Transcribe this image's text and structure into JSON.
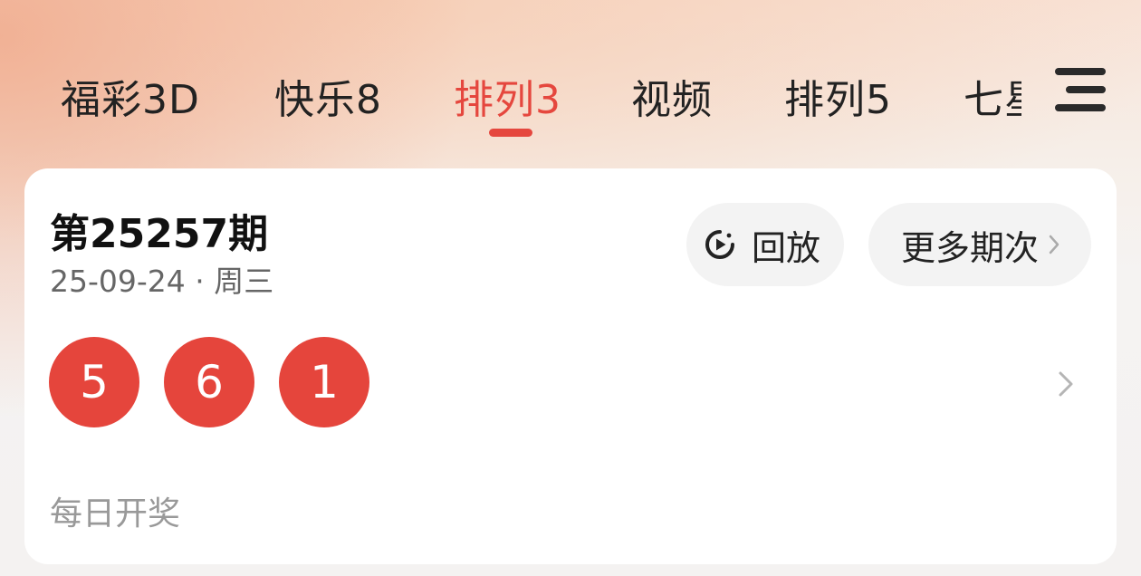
{
  "tabs": [
    {
      "label": "福彩3D"
    },
    {
      "label": "快乐8"
    },
    {
      "label": "排列3",
      "active": true
    },
    {
      "label": "视频"
    },
    {
      "label": "排列5"
    },
    {
      "label": "七星彩"
    }
  ],
  "menu_icon": "hamburger-menu-icon",
  "draw": {
    "issue": "第25257期",
    "date": "25-09-24 · 周三",
    "numbers": [
      "5",
      "6",
      "1"
    ],
    "schedule": "每日开奖"
  },
  "actions": {
    "replay_label": "回放",
    "replay_icon": "play-replay-icon",
    "more_label": "更多期次"
  },
  "colors": {
    "accent": "#e5473e",
    "ball": "#e5453c"
  }
}
